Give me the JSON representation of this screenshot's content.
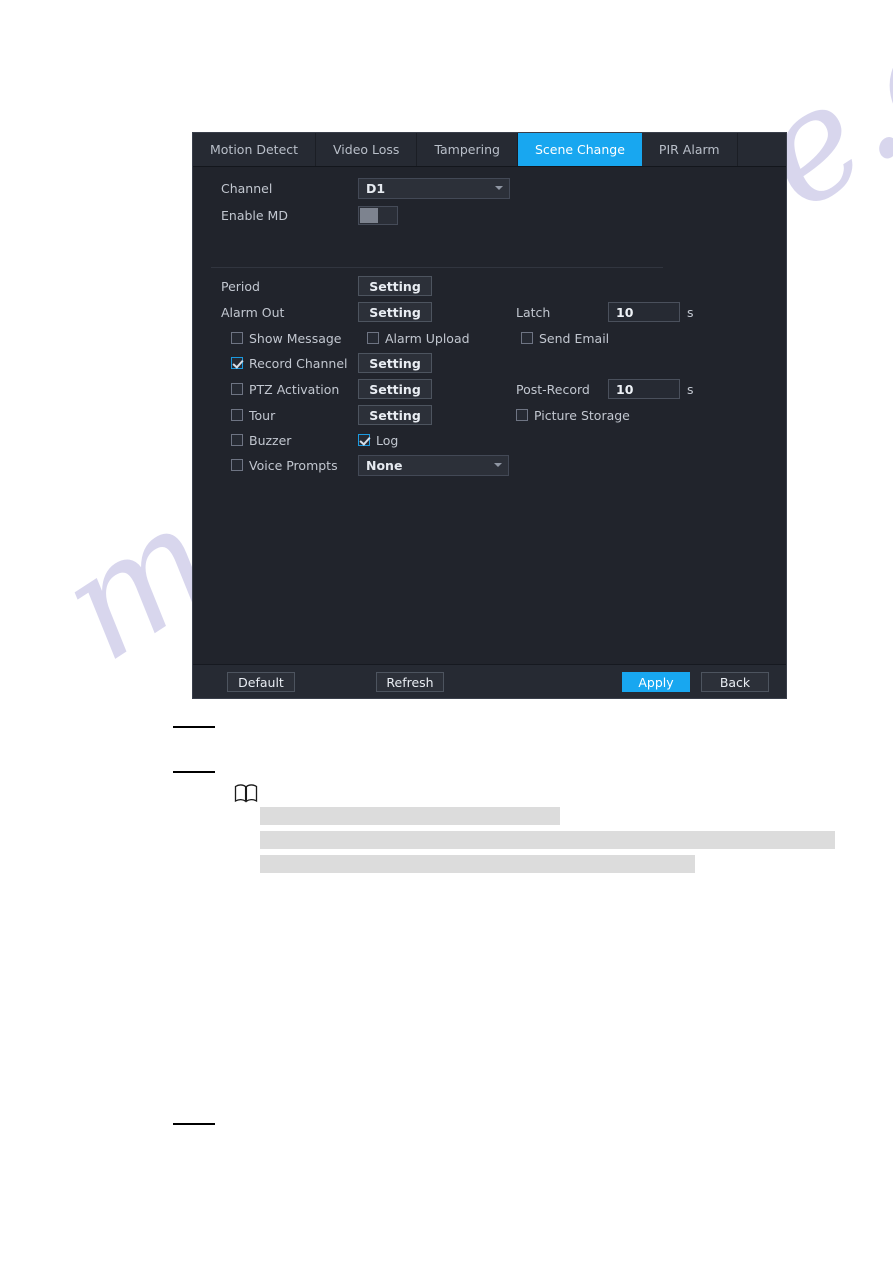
{
  "page": {
    "watermark": "manualshive.com"
  },
  "dialog": {
    "tabs": [
      {
        "label": "Motion Detect",
        "active": false
      },
      {
        "label": "Video Loss",
        "active": false
      },
      {
        "label": "Tampering",
        "active": false
      },
      {
        "label": "Scene Change",
        "active": true
      },
      {
        "label": "PIR Alarm",
        "active": false
      }
    ],
    "fields": {
      "channel_label": "Channel",
      "channel_value": "D1",
      "enable_md_label": "Enable MD",
      "enable_md_state": "off",
      "period_label": "Period",
      "period_button": "Setting",
      "alarm_out_label": "Alarm Out",
      "alarm_out_button": "Setting",
      "latch_label": "Latch",
      "latch_value": "10",
      "latch_unit": "s",
      "show_message_label": "Show Message",
      "show_message_checked": false,
      "alarm_upload_label": "Alarm Upload",
      "alarm_upload_checked": false,
      "send_email_label": "Send Email",
      "send_email_checked": false,
      "record_channel_label": "Record Channel",
      "record_channel_checked": true,
      "record_channel_button": "Setting",
      "ptz_activation_label": "PTZ Activation",
      "ptz_activation_checked": false,
      "ptz_activation_button": "Setting",
      "post_record_label": "Post-Record",
      "post_record_value": "10",
      "post_record_unit": "s",
      "tour_label": "Tour",
      "tour_checked": false,
      "tour_button": "Setting",
      "picture_storage_label": "Picture Storage",
      "picture_storage_checked": false,
      "buzzer_label": "Buzzer",
      "buzzer_checked": false,
      "log_label": "Log",
      "log_checked": true,
      "voice_prompts_label": "Voice Prompts",
      "voice_prompts_checked": false,
      "voice_prompts_value": "None"
    },
    "footer": {
      "default_label": "Default",
      "refresh_label": "Refresh",
      "apply_label": "Apply",
      "back_label": "Back"
    },
    "colors": {
      "accent": "#18a7f0",
      "panel": "#262a33",
      "body": "#21242c"
    }
  }
}
